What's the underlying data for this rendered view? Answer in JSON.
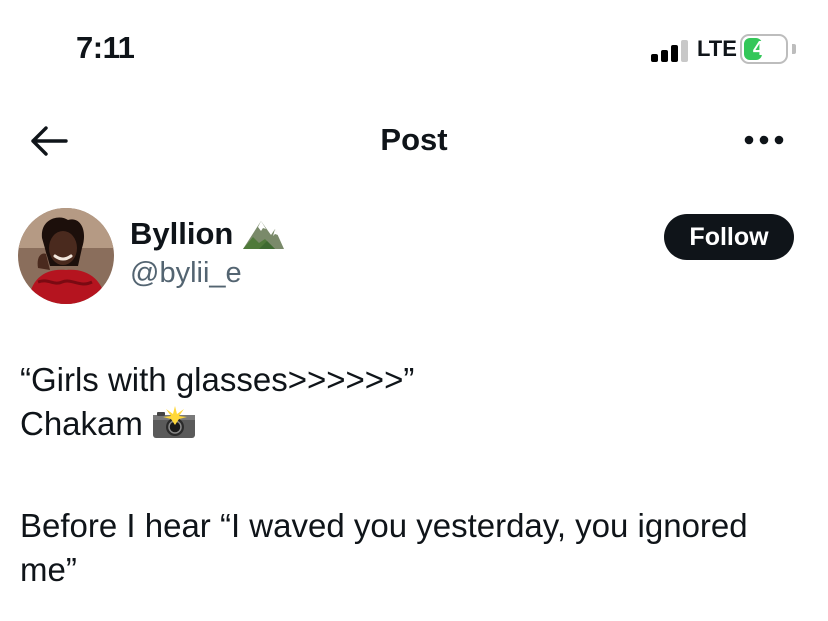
{
  "status_bar": {
    "time": "7:11",
    "network": "LTE",
    "battery": "45",
    "battery_level": 0.45,
    "battery_color": "#34c759"
  },
  "nav": {
    "title": "Post",
    "back_icon": "arrow-left-icon",
    "more_icon": "more-horizontal-icon"
  },
  "author": {
    "display_name": "Byllion",
    "name_emoji": "mountain-icon",
    "handle": "@bylii_e",
    "follow_label": "Follow"
  },
  "post": {
    "line1": "“Girls with glasses>>>>>>”",
    "line2": "Chakam",
    "line2_emoji": "camera-flash-icon",
    "line3": "Before I hear “I waved you yesterday, you ignored",
    "line4": "me”"
  }
}
